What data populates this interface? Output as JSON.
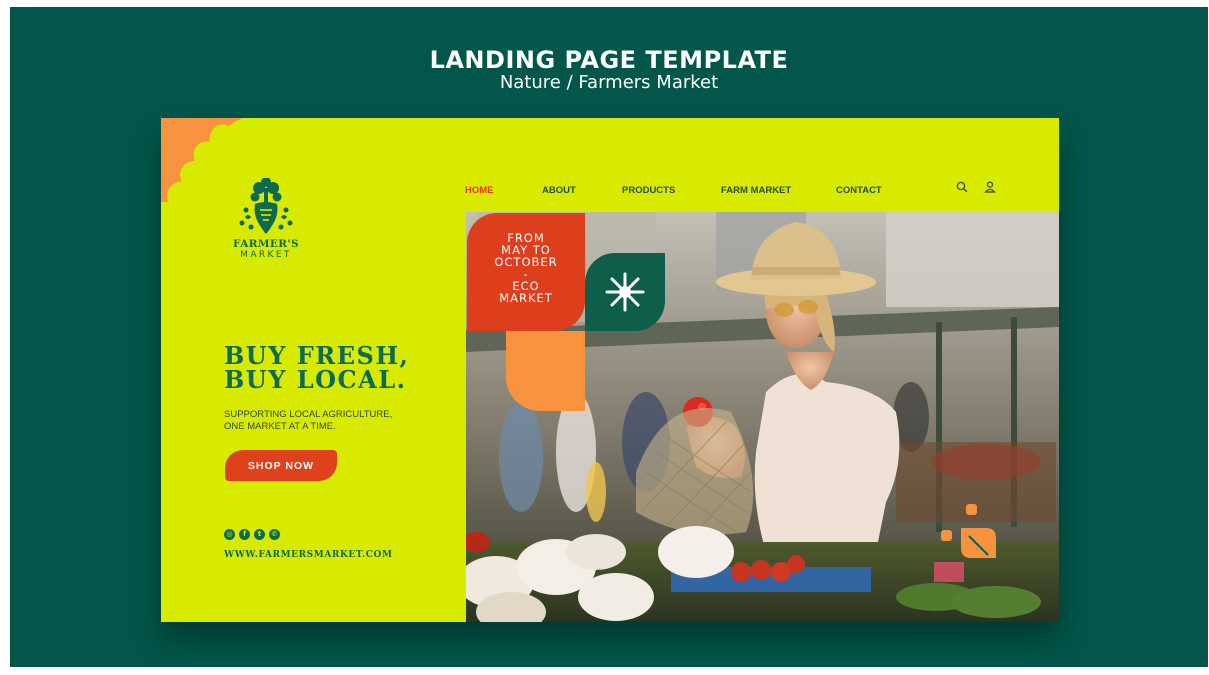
{
  "header": {
    "title": "LANDING PAGE TEMPLATE",
    "subtitle": "Nature / Farmers Market"
  },
  "brand": {
    "name": "FARMER'S",
    "sub": "MARKET"
  },
  "nav": {
    "items": [
      {
        "label": "HOME",
        "active": true
      },
      {
        "label": "ABOUT",
        "active": false
      },
      {
        "label": "PRODUCTS",
        "active": false
      },
      {
        "label": "FARM MARKET",
        "active": false
      },
      {
        "label": "CONTACT",
        "active": false
      }
    ],
    "icons": [
      "search-icon",
      "user-icon"
    ]
  },
  "hero": {
    "title_line1": "BUY FRESH,",
    "title_line2": "BUY LOCAL.",
    "subtitle_line1": "SUPPORTING LOCAL AGRICULTURE,",
    "subtitle_line2": "ONE MARKET AT A TIME.",
    "cta_label": "SHOP NOW"
  },
  "badge": {
    "lines": [
      "FROM",
      "MAY TO",
      "OCTOBER",
      "-",
      "ECO",
      "MARKET"
    ]
  },
  "social": {
    "icons": [
      "instagram-icon",
      "facebook-icon",
      "twitter-icon",
      "whatsapp-icon"
    ],
    "url": "WWW.FARMERSMARKET.COM"
  },
  "colors": {
    "background": "#02574a",
    "card": "#d8ea00",
    "accent_red": "#dd3f1c",
    "accent_orange": "#f7923f",
    "accent_green": "#0d6a4f"
  }
}
